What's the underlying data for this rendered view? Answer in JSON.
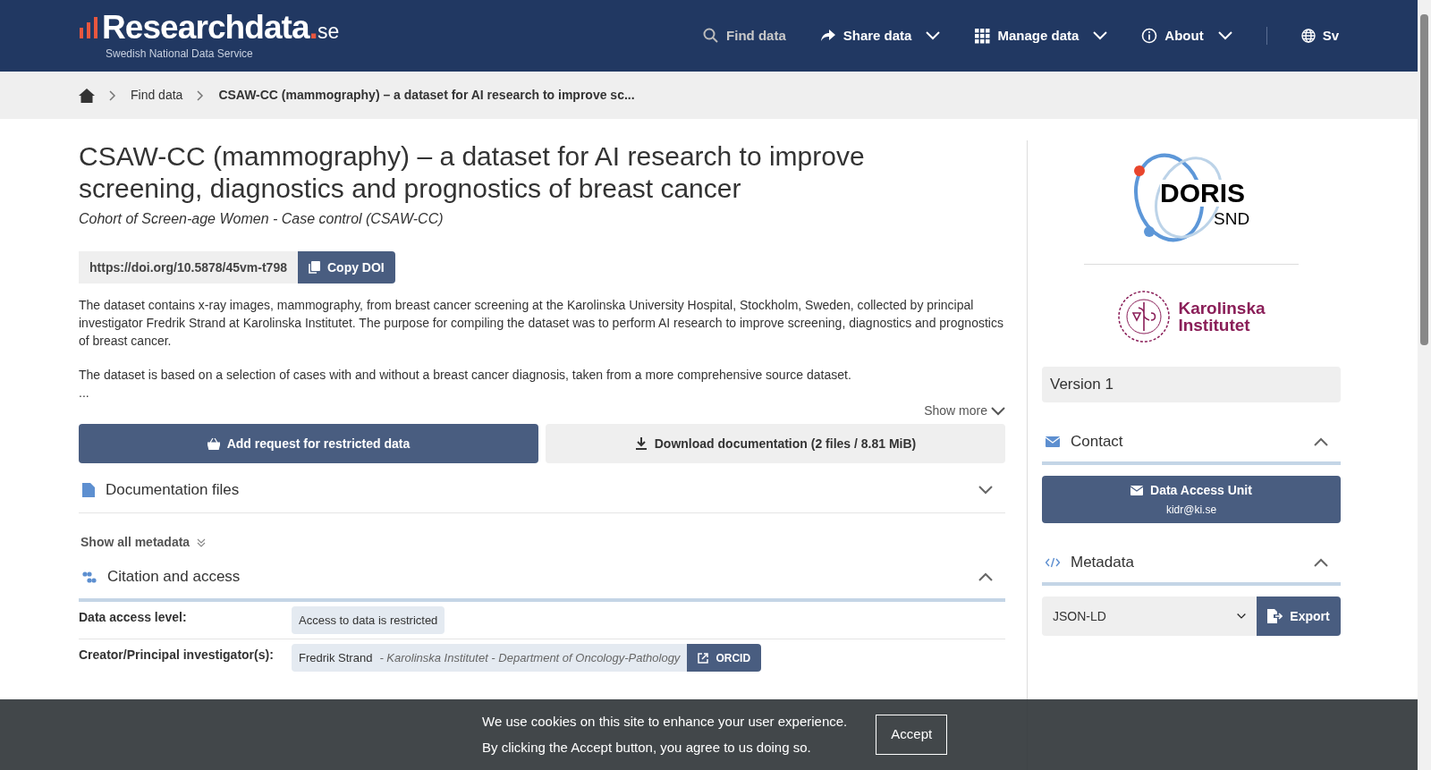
{
  "header": {
    "logo": {
      "name": "Researchdata",
      "tld": ".se",
      "tagline": "Swedish National Data Service"
    },
    "nav": [
      {
        "label": "Find data",
        "caret": false,
        "muted": true
      },
      {
        "label": "Share data",
        "caret": true,
        "muted": false
      },
      {
        "label": "Manage data",
        "caret": true,
        "muted": false
      },
      {
        "label": "About",
        "caret": true,
        "muted": false
      }
    ],
    "language": "Sv"
  },
  "breadcrumbs": [
    "Find data",
    "CSAW-CC (mammography) – a dataset for AI research to improve sc..."
  ],
  "title": "CSAW-CC (mammography) – a dataset for AI research to improve screening, diagnostics and prognostics of breast cancer",
  "subtitle": "Cohort of Screen-age Women - Case control (CSAW-CC)",
  "doi": {
    "url": "https://doi.org/10.5878/45vm-t798",
    "button": "Copy DOI"
  },
  "description": [
    "The dataset contains x-ray images, mammography, from breast cancer screening at the Karolinska University Hospital, Stockholm, Sweden, collected by principal investigator Fredrik Strand at Karolinska Institutet. The purpose for compiling the dataset was to perform AI research to improve screening, diagnostics and prognostics of breast cancer.",
    "The dataset is based on a selection of cases with and without a breast cancer diagnosis, taken from a more comprehensive source dataset.\n..."
  ],
  "show_more": "Show more",
  "actions": [
    {
      "label": "Add request for restricted data",
      "kind": "primary"
    },
    {
      "label": "Download documentation (2 files / 8.81 MiB)",
      "kind": "secondary"
    }
  ],
  "documentation": {
    "title": "Documentation files",
    "expanded": false
  },
  "show_all_metadata": "Show all metadata",
  "citation": {
    "title": "Citation and access",
    "expanded": true,
    "rows": [
      {
        "label": "Data access level:",
        "values": [
          {
            "text": "Access to data is restricted"
          }
        ]
      },
      {
        "label": "Creator/Principal investigator(s):",
        "values": [
          {
            "text": "Fredrik Strand",
            "detail": "- Karolinska Institutet - Department of Oncology-Pathology",
            "link": "ORCID"
          }
        ]
      }
    ]
  },
  "sidebar": {
    "logos": {
      "doris": "DORIS",
      "snd": "SND",
      "ki_line1": "Karolinska",
      "ki_line2": "Institutet"
    },
    "version": "Version 1",
    "contact": {
      "title": "Contact",
      "expanded": true,
      "button": {
        "name": "Data Access Unit",
        "email": "kidr@ki.se"
      }
    },
    "metadata": {
      "title": "Metadata",
      "expanded": true,
      "format": "JSON-LD",
      "button": "Export"
    }
  },
  "cookie": {
    "lines": [
      "We use cookies on this site to enhance your user experience.",
      "By clicking the Accept button, you agree to us doing so."
    ],
    "button": "Accept"
  }
}
